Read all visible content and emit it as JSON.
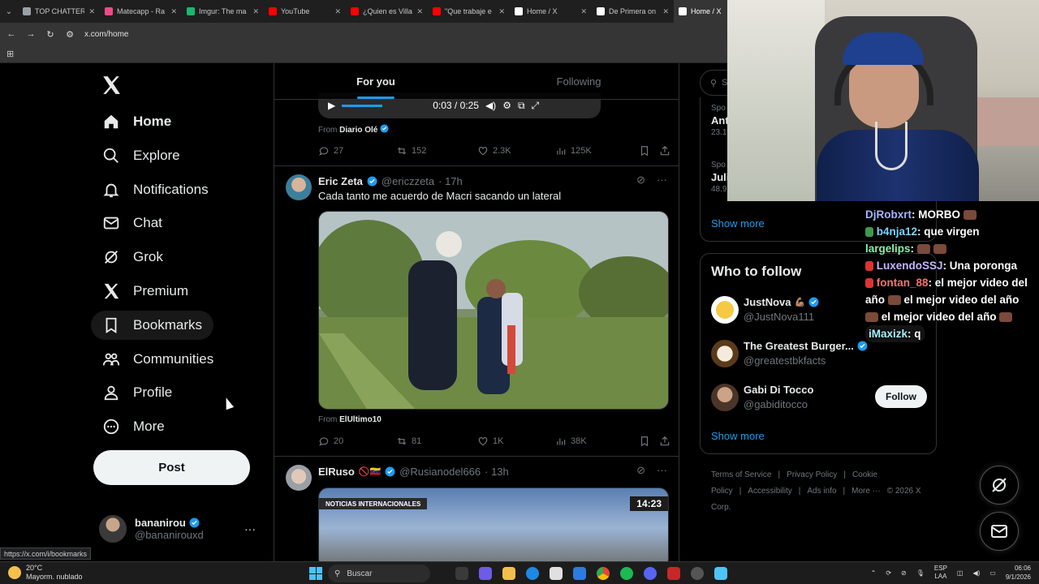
{
  "browser": {
    "tabs": [
      {
        "label": "TOP CHATTERS",
        "color": "#9aa0a6"
      },
      {
        "label": "Matecapp - Ra",
        "color": "#ea4c89"
      },
      {
        "label": "Imgur: The ma",
        "color": "#1bb76e"
      },
      {
        "label": "YouTube",
        "color": "#ff0000"
      },
      {
        "label": "¿Quien es Villa",
        "color": "#ff0000"
      },
      {
        "label": "\"Que trabaje e",
        "color": "#ff0000"
      },
      {
        "label": "Home / X",
        "color": "#ffffff"
      },
      {
        "label": "De Primera on",
        "color": "#ffffff"
      },
      {
        "label": "Home / X",
        "color": "#ffffff"
      }
    ],
    "url": "x.com/home",
    "status_url": "https://x.com/i/bookmarks"
  },
  "nav": {
    "items": [
      {
        "label": "Home",
        "icon": "home-icon"
      },
      {
        "label": "Explore",
        "icon": "search-icon"
      },
      {
        "label": "Notifications",
        "icon": "bell-icon"
      },
      {
        "label": "Chat",
        "icon": "mail-icon"
      },
      {
        "label": "Grok",
        "icon": "grok-icon"
      },
      {
        "label": "Premium",
        "icon": "x-logo-icon"
      },
      {
        "label": "Bookmarks",
        "icon": "bookmark-icon"
      },
      {
        "label": "Communities",
        "icon": "people-icon"
      },
      {
        "label": "Profile",
        "icon": "person-icon"
      },
      {
        "label": "More",
        "icon": "more-circle-icon"
      }
    ],
    "post_label": "Post",
    "account": {
      "name": "bananirou",
      "handle": "@bananirouxd"
    }
  },
  "feed": {
    "tabs": [
      "For you",
      "Following"
    ],
    "video_time": "0:03 / 0:25",
    "post1": {
      "from_label": "From",
      "source": "Diario Olé",
      "replies": "27",
      "reposts": "152",
      "likes": "2.3K",
      "views": "125K"
    },
    "post2": {
      "name": "Eric Zeta",
      "handle": "@ericzzeta",
      "time": "· 17h",
      "text": "Cada tanto me acuerdo de Macri sacando un lateral",
      "from_label": "From",
      "source": "ElUltimo10",
      "replies": "20",
      "reposts": "81",
      "likes": "1K",
      "views": "38K"
    },
    "post3": {
      "name": "ElRuso",
      "handle": "@Rusianodel666",
      "time": "· 13h",
      "media_caption": "NOTICIAS INTERNACIONALES",
      "media_time": "14:23"
    }
  },
  "sidebar": {
    "search_placeholder": "S",
    "trends": [
      {
        "category": "Spo",
        "title": "Ant",
        "count": "23.1"
      },
      {
        "category": "Spo",
        "title": "Juli",
        "count": "48.9"
      }
    ],
    "show_more": "Show more",
    "who_to_follow": {
      "title": "Who to follow",
      "accounts": [
        {
          "name": "JustNova",
          "handle": "@JustNova111"
        },
        {
          "name": "The Greatest Burger...",
          "handle": "@greatestbkfacts"
        },
        {
          "name": "Gabi Di Tocco",
          "handle": "@gabiditocco",
          "button": "Follow"
        }
      ],
      "show_more": "Show more"
    },
    "footer": [
      "Terms of Service",
      "|",
      "Privacy Policy",
      "|",
      "Cookie Policy",
      "|",
      "Accessibility",
      "|",
      "Ads info",
      "|",
      "More ···",
      "© 2026 X Corp."
    ]
  },
  "stream_chat": [
    {
      "user": "DjRobxrt",
      "msg": ": MORBO"
    },
    {
      "user": "b4nja12",
      "msg": ": que virgen"
    },
    {
      "user": "largelips",
      "msg": ":"
    },
    {
      "user": "LuxendoSSJ",
      "msg": ": Una poronga"
    },
    {
      "user": "fontan_88",
      "msg": ": el mejor video del"
    },
    {
      "user": "año",
      "msg": "el mejor video del año"
    },
    {
      "user": "",
      "msg": "el mejor video del año"
    },
    {
      "user": "iMaxizk",
      "msg": ": q"
    }
  ],
  "taskbar": {
    "temp": "20°C",
    "weather": "Mayorm. nublado",
    "search": "Buscar",
    "lang1": "ESP",
    "lang2": "LAA",
    "time": "06:06",
    "date": "9/1/2026"
  }
}
